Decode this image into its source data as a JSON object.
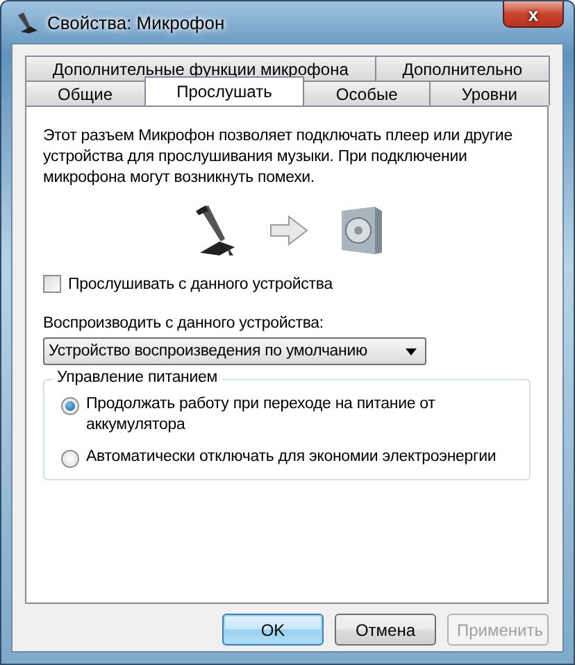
{
  "window": {
    "title": "Свойства: Микрофон",
    "close_label": "x"
  },
  "tab_rows": [
    [
      {
        "label": "Дополнительные функции микрофона",
        "selected": false
      },
      {
        "label": "Дополнительно",
        "selected": false
      }
    ],
    [
      {
        "label": "Общие",
        "selected": false
      },
      {
        "label": "Прослушать",
        "selected": true
      },
      {
        "label": "Особые",
        "selected": false
      },
      {
        "label": "Уровни",
        "selected": false
      }
    ]
  ],
  "description": "Этот разъем Микрофон позволяет подключать плеер или другие устройства для прослушивания музыки. При подключении микрофона могут возникнуть помехи.",
  "listen_checkbox": {
    "label": "Прослушивать с данного устройства",
    "checked": false
  },
  "playback": {
    "label": "Воспроизводить с данного устройства:",
    "value": "Устройство воспроизведения по умолчанию"
  },
  "power": {
    "title": "Управление питанием",
    "options": [
      {
        "label": "Продолжать работу при переходе на питание от аккумулятора",
        "selected": true
      },
      {
        "label": "Автоматически отключать для экономии электроэнергии",
        "selected": false
      }
    ]
  },
  "buttons": [
    {
      "label": "OK",
      "kind": "default",
      "disabled": false
    },
    {
      "label": "Отмена",
      "kind": "normal",
      "disabled": false
    },
    {
      "label": "Применить",
      "kind": "normal",
      "disabled": true
    }
  ]
}
